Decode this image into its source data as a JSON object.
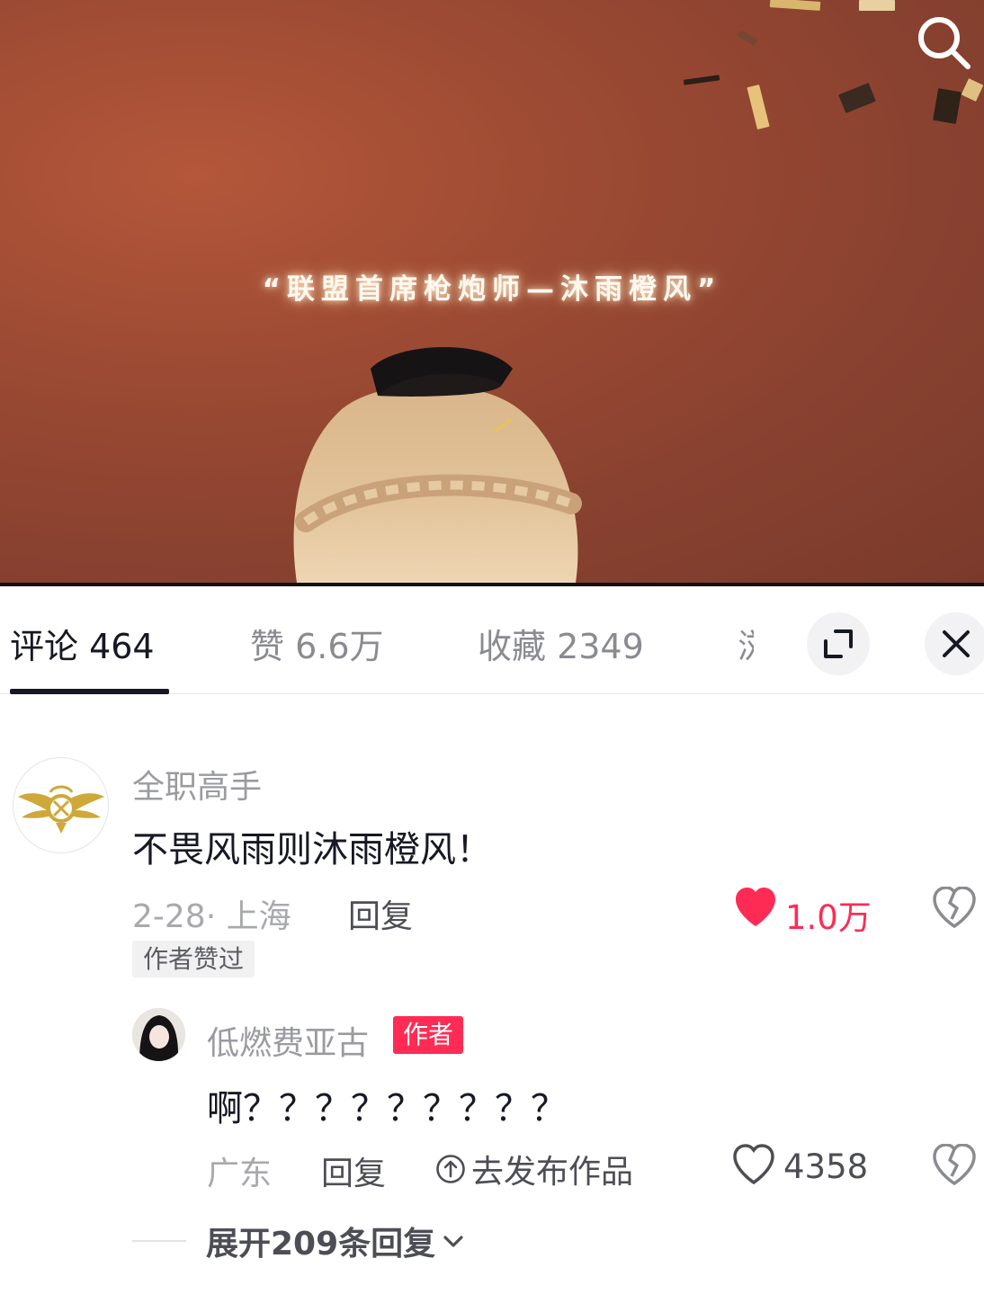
{
  "video": {
    "subtitle": "“联盟首席枪炮师—沐雨橙风”"
  },
  "tabs": [
    {
      "label": "评论 464",
      "active": true
    },
    {
      "label": "赞 6.6万",
      "active": false
    },
    {
      "label": "收藏 2349",
      "active": false
    },
    {
      "label": "浏",
      "active": false
    }
  ],
  "colors": {
    "accent": "#fe2c55",
    "text": "#161823",
    "muted": "#9a9ba0"
  },
  "comments": [
    {
      "username": "全职高手",
      "text": "不畏风雨则沐雨橙风！",
      "date_location": "2-28· 上海",
      "reply_label": "回复",
      "likes": "1.0万",
      "liked": true,
      "badge": "作者赞过",
      "avatar_icon": "glory-wings-logo"
    }
  ],
  "reply": {
    "username": "低燃费亚古",
    "author_badge": "作者",
    "text": "啊？？？？？？？？？",
    "location": "广东",
    "reply_label": "回复",
    "publish_label": "去发布作品",
    "likes": "4358",
    "liked": false
  },
  "expand": {
    "label": "展开209条回复"
  }
}
